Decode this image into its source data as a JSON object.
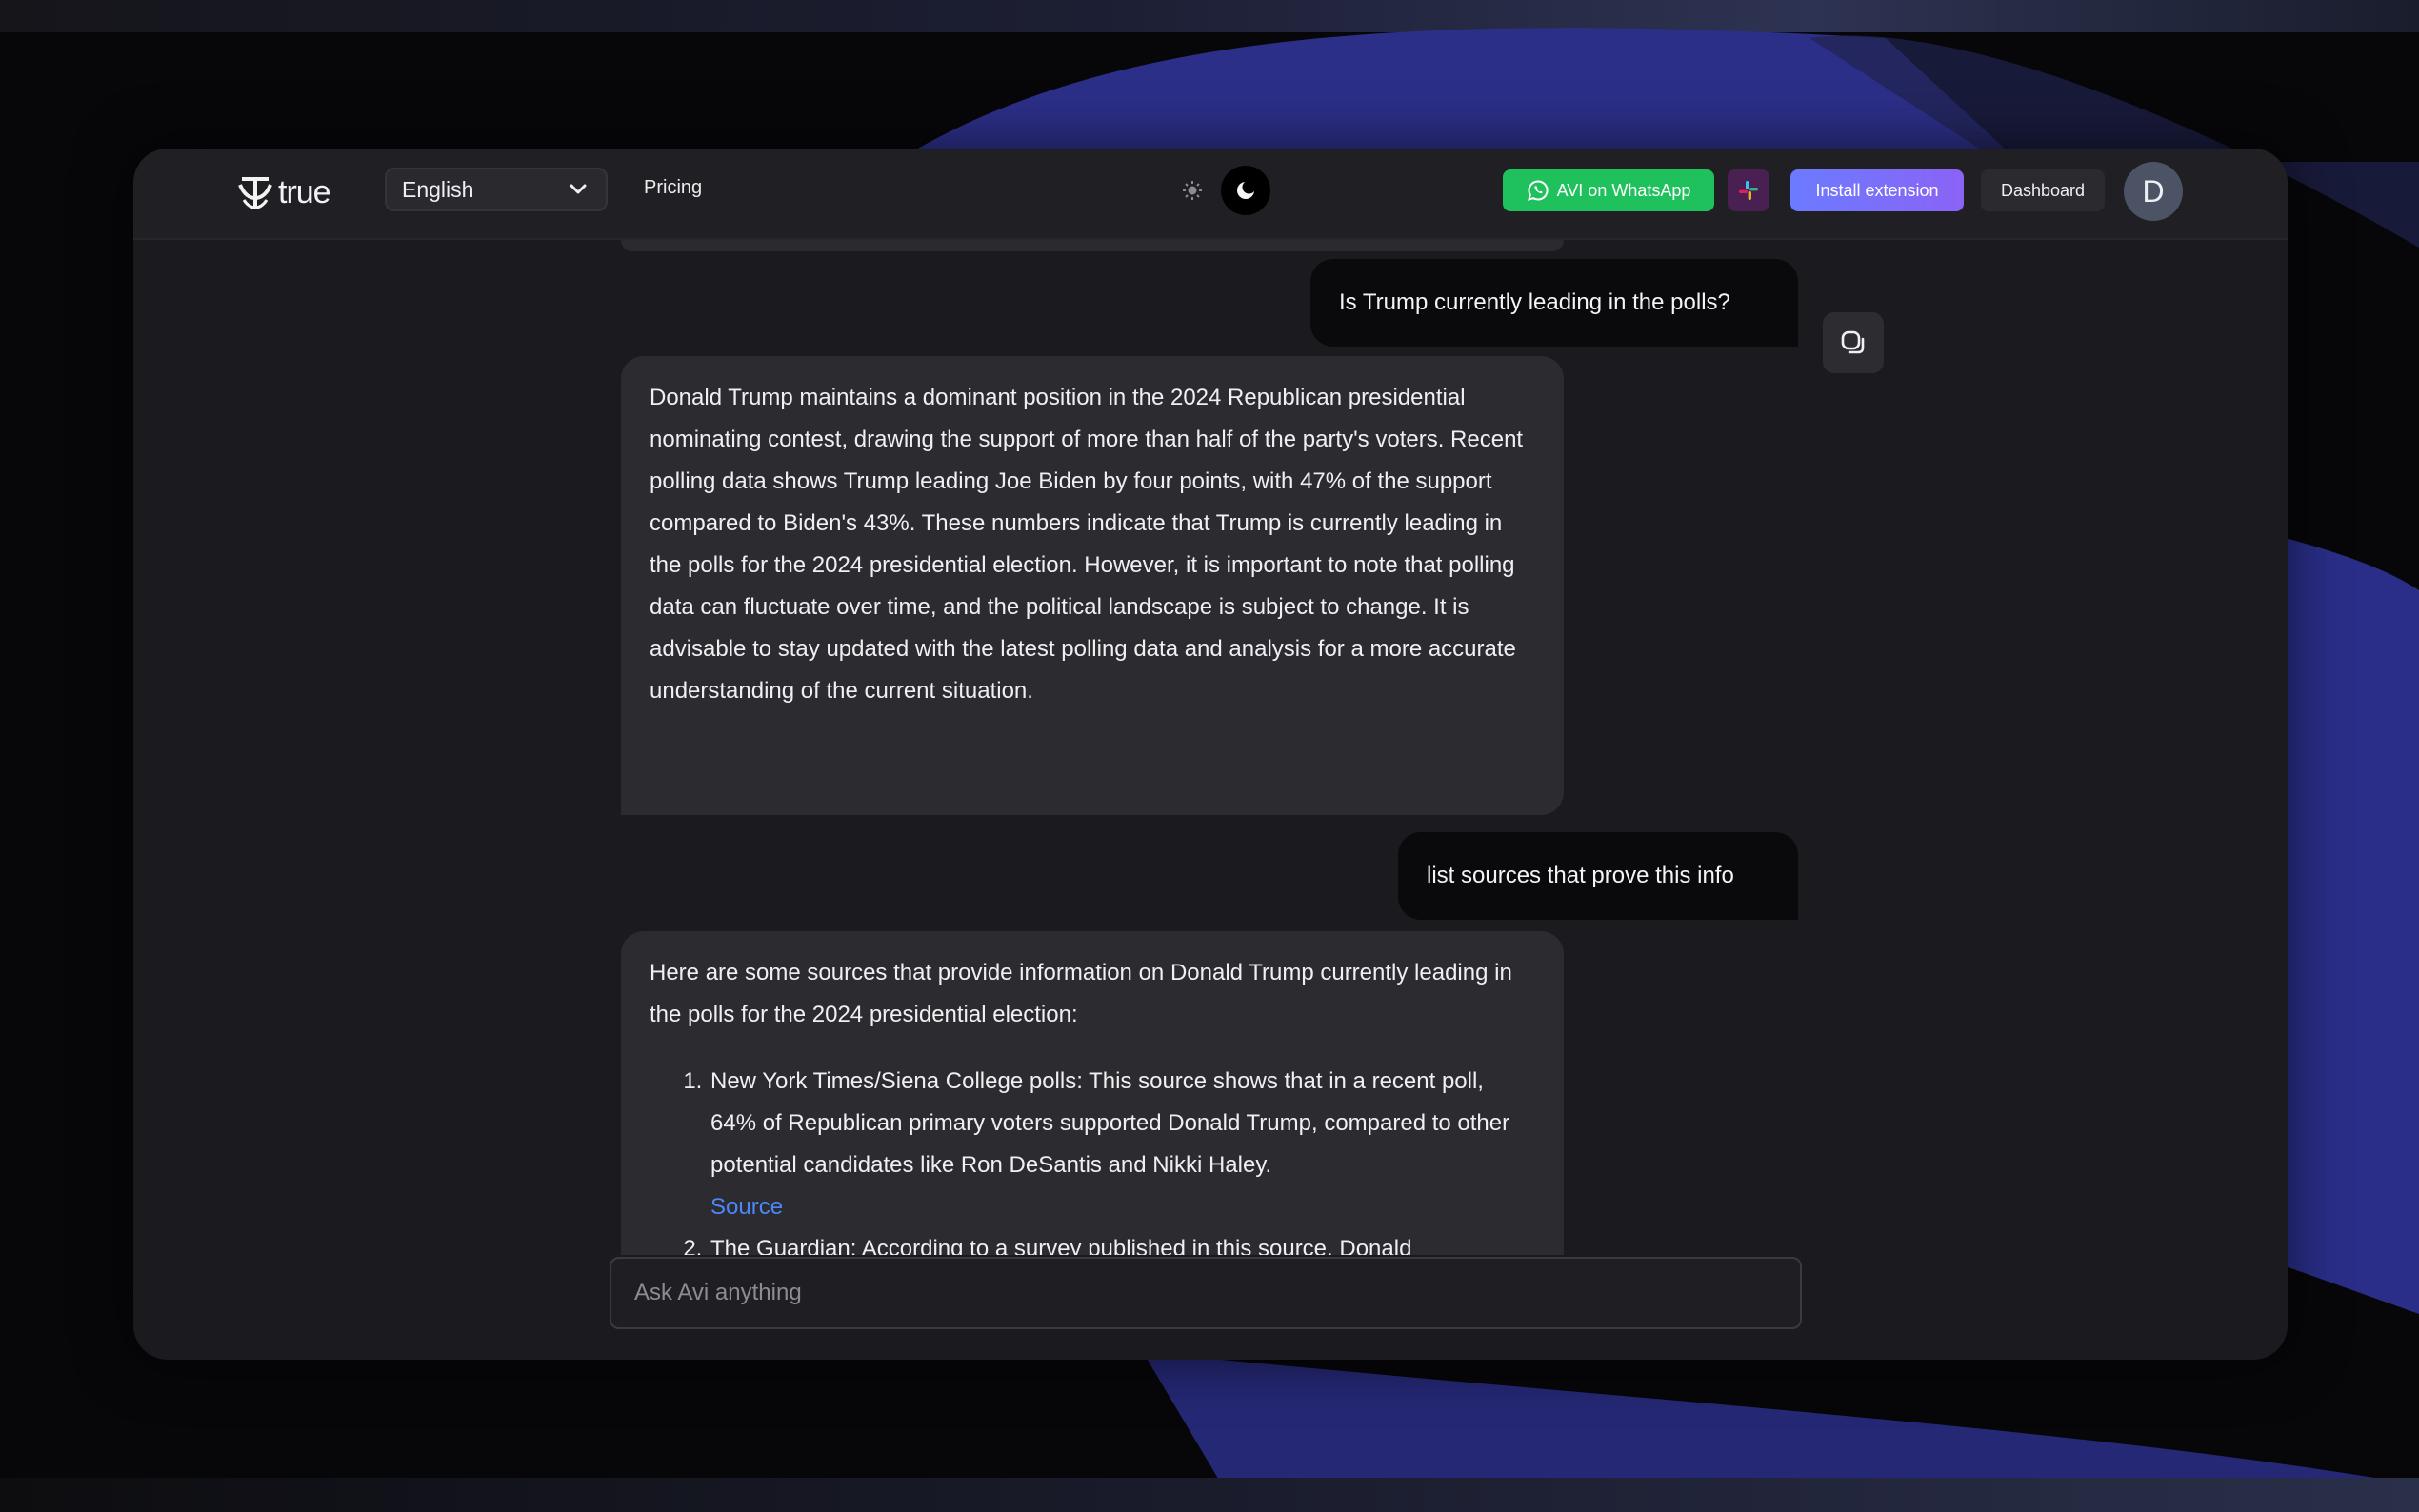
{
  "navbar": {
    "logo_text": "true",
    "language": "English",
    "pricing": "Pricing",
    "whatsapp_label": "AVI on WhatsApp",
    "install_label": "Install extension",
    "dashboard_label": "Dashboard",
    "avatar_initial": "D"
  },
  "conversation": {
    "user_message_1": "Is Trump currently leading in the polls?",
    "ai_response_1": "Donald Trump maintains a dominant position in the 2024 Republican presidential nominating contest, drawing the support of more than half of the party's voters. Recent polling data shows Trump leading Joe Biden by four points, with 47% of the support compared to Biden's 43%. These numbers indicate that Trump is currently leading in the polls for the 2024 presidential election. However, it is important to note that polling data can fluctuate over time, and the political landscape is subject to change. It is advisable to stay updated with the latest polling data and analysis for a more accurate understanding of the current situation.",
    "user_message_2": "list sources that prove this info",
    "ai_response_2_intro": "Here are some sources that provide information on Donald Trump currently leading in the polls for the 2024 presidential election:",
    "sources": [
      {
        "text": "New York Times/Siena College polls: This source shows that in a recent poll, 64% of Republican primary voters supported Donald Trump, compared to other potential candidates like Ron DeSantis and Nikki Haley.",
        "link_label": "Source"
      },
      {
        "text": "The Guardian: According to a survey published in this source, Donald",
        "link_label": ""
      }
    ]
  },
  "input": {
    "placeholder": "Ask Avi anything"
  },
  "colors": {
    "app_background": "#1b1b1f",
    "ai_bubble": "#2b2b30",
    "user_bubble": "#0a0a0c",
    "whatsapp_green": "#1fc15c",
    "install_gradient_start": "#6c7bff",
    "link_blue": "#4d86f7"
  }
}
